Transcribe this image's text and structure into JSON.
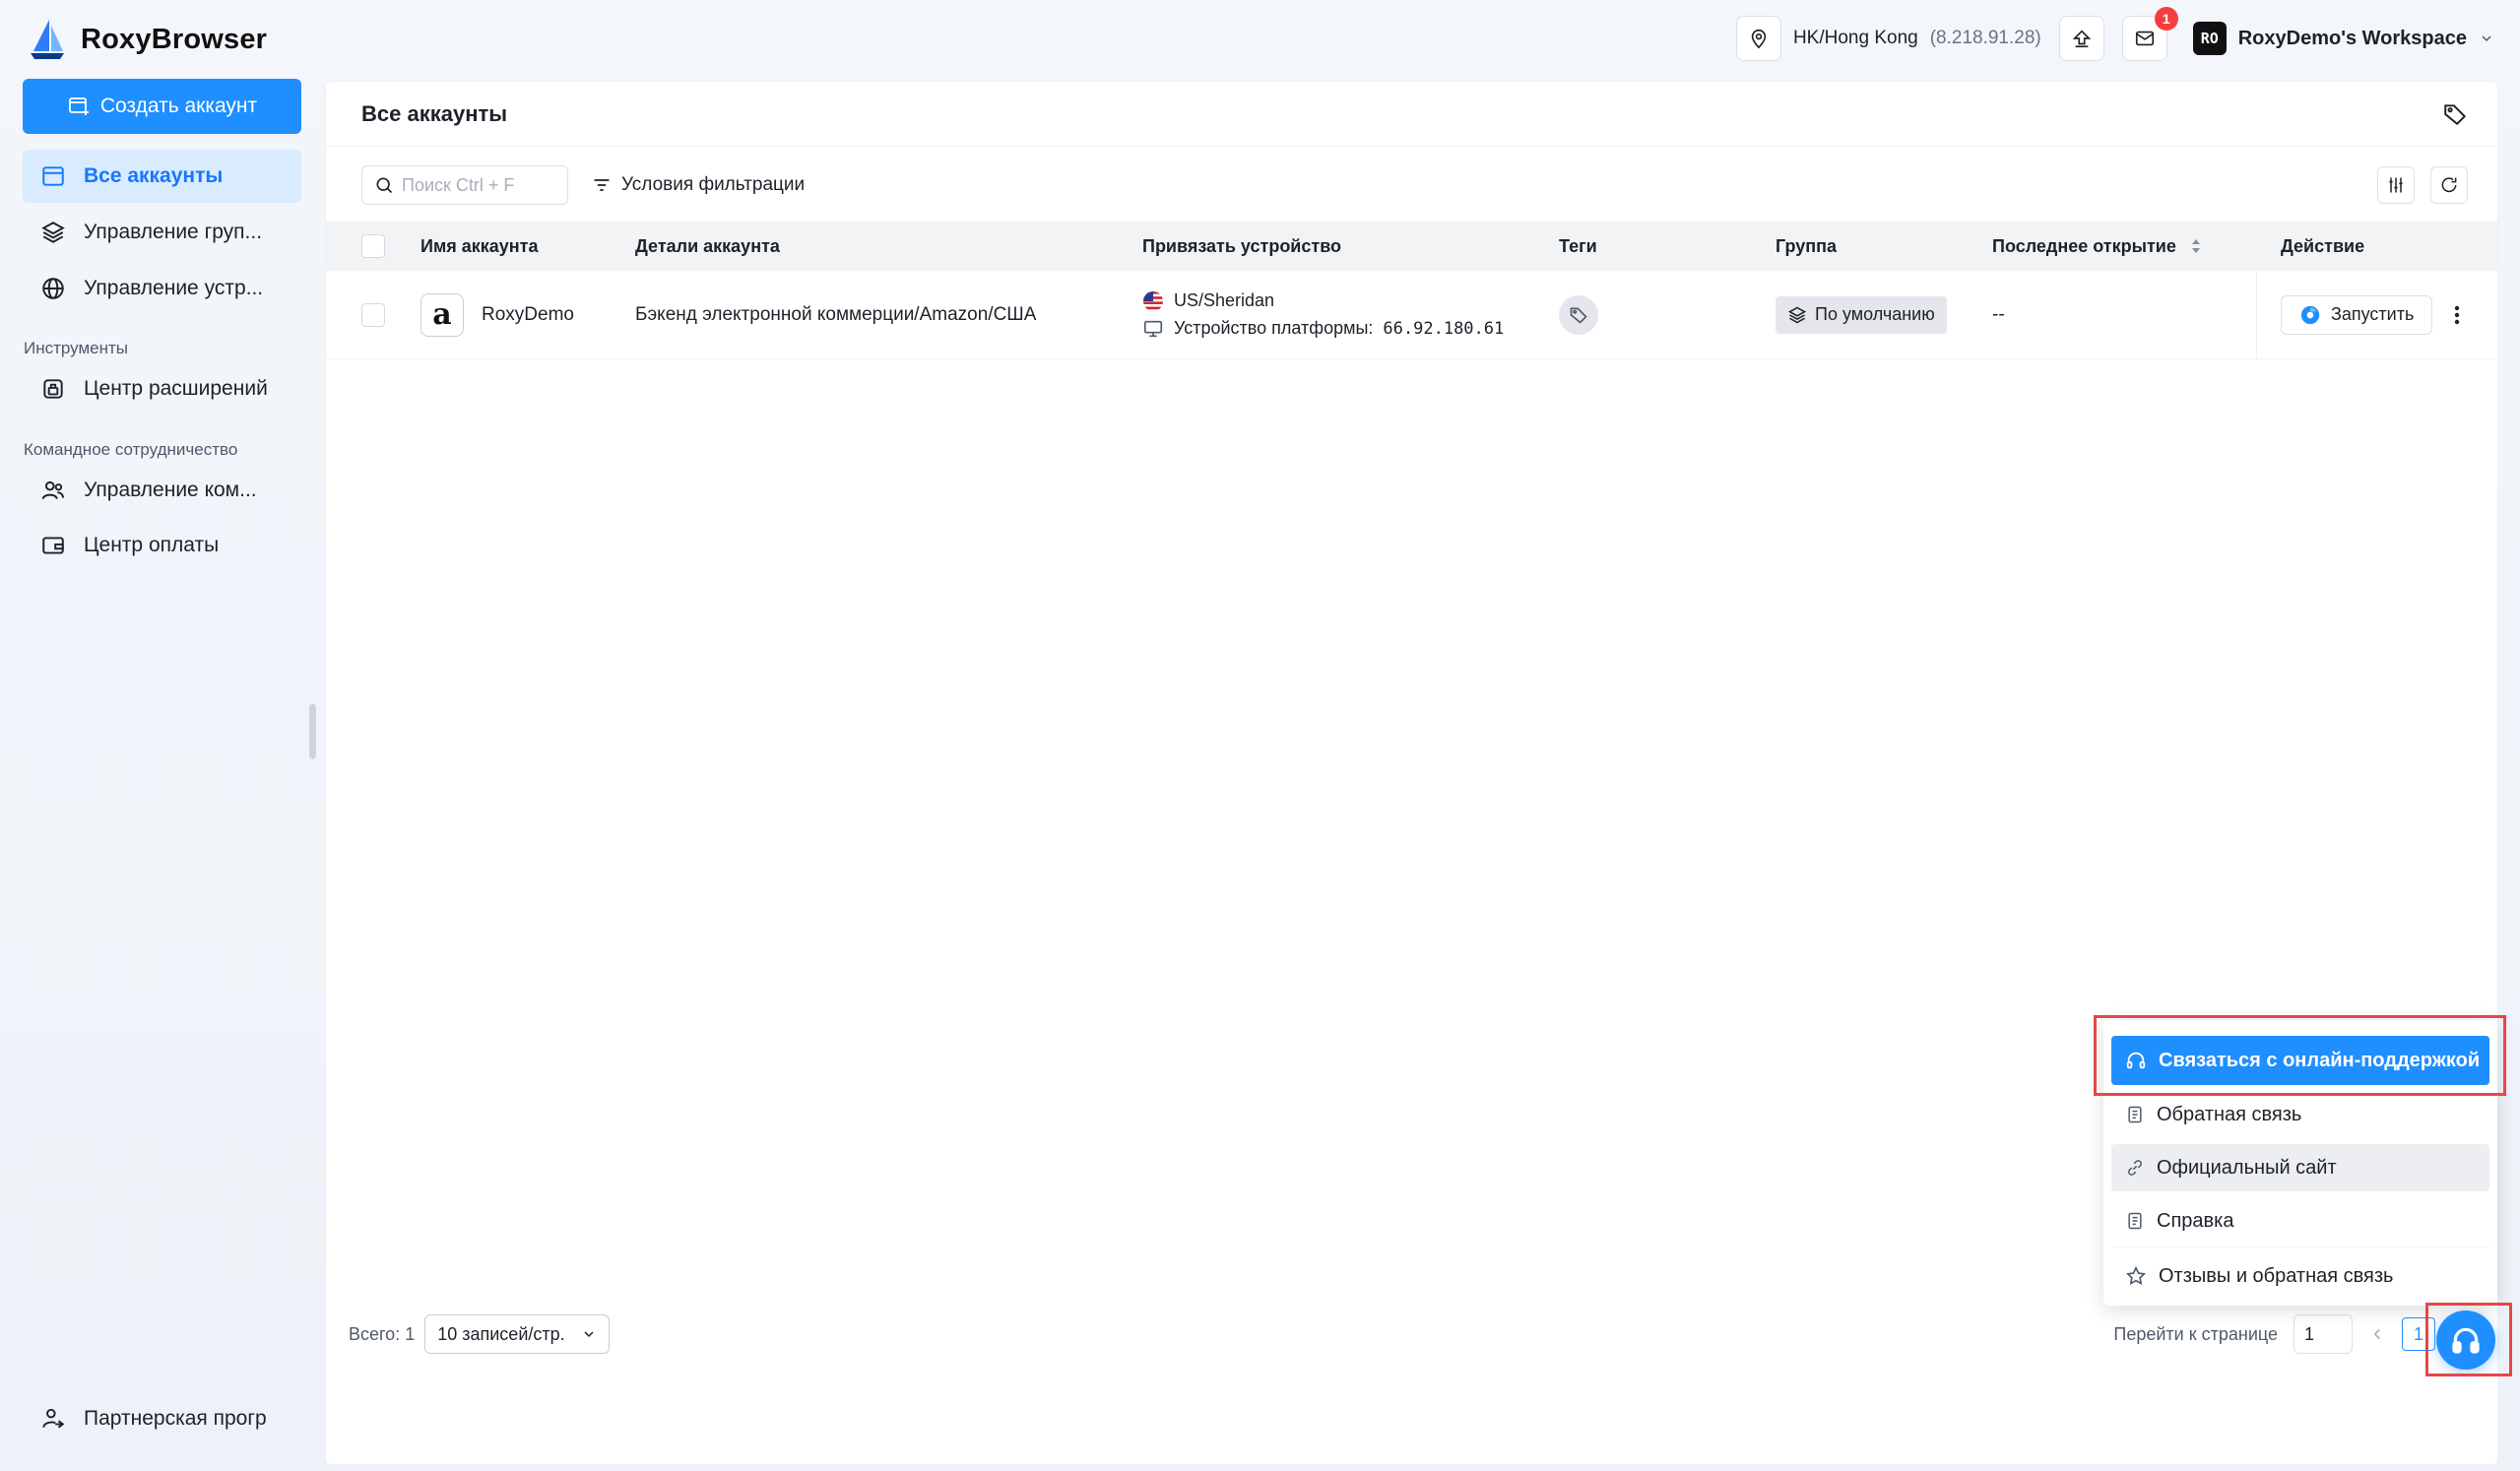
{
  "app": {
    "name": "RoxyBrowser"
  },
  "topbar": {
    "location": "HK/Hong Kong",
    "ip": "(8.218.91.28)",
    "mail_badge": "1",
    "workspace_avatar": "RO",
    "workspace_name": "RoxyDemo's Workspace"
  },
  "sidebar": {
    "create_label": "Создать аккаунт",
    "items": [
      {
        "label": "Все аккаунты",
        "icon": "window-icon"
      },
      {
        "label": "Управление груп...",
        "icon": "layers-icon"
      },
      {
        "label": "Управление устр...",
        "icon": "globe-icon"
      }
    ],
    "section_tools": "Инструменты",
    "tools_items": [
      {
        "label": "Центр расширений",
        "icon": "extension-icon"
      }
    ],
    "section_team": "Командное сотрудничество",
    "team_items": [
      {
        "label": "Управление ком...",
        "icon": "team-icon"
      },
      {
        "label": "Центр оплаты",
        "icon": "wallet-icon"
      }
    ],
    "partner_label": "Партнерская прогр"
  },
  "main": {
    "title": "Все аккаунты",
    "search_placeholder": "Поиск Ctrl + F",
    "filter_label": "Условия фильтрации",
    "columns": [
      "Имя аккаунта",
      "Детали аккаунта",
      "Привязать устройство",
      "Теги",
      "Группа",
      "Последнее открытие",
      "Действие"
    ],
    "rows": [
      {
        "name": "RoxyDemo",
        "details": "Бэкенд электронной коммерции/Amazon/США",
        "device_location": "US/Sheridan",
        "device_platform_label": "Устройство платформы:",
        "device_ip": "66.92.180.61",
        "group": "По умолчанию",
        "last_opened": "--",
        "action": "Запустить"
      }
    ],
    "footer": {
      "total": "Всего: 1",
      "page_size": "10 записей/стр.",
      "goto_label": "Перейти к странице",
      "goto_value": "1",
      "current_page": "1"
    }
  },
  "help_menu": {
    "items": [
      {
        "label": "Связаться с онлайн-поддержкой",
        "icon": "headset-icon"
      },
      {
        "label": "Обратная связь",
        "icon": "document-icon"
      },
      {
        "label": "Официальный сайт",
        "icon": "link-icon"
      },
      {
        "label": "Справка",
        "icon": "document-icon"
      },
      {
        "label": "Отзывы и обратная связь",
        "icon": "star-icon"
      }
    ]
  },
  "colors": {
    "accent": "#1f8fff",
    "highlight": "#e54848",
    "active_bg": "#d9ebff",
    "badge": "#f53f3f"
  }
}
